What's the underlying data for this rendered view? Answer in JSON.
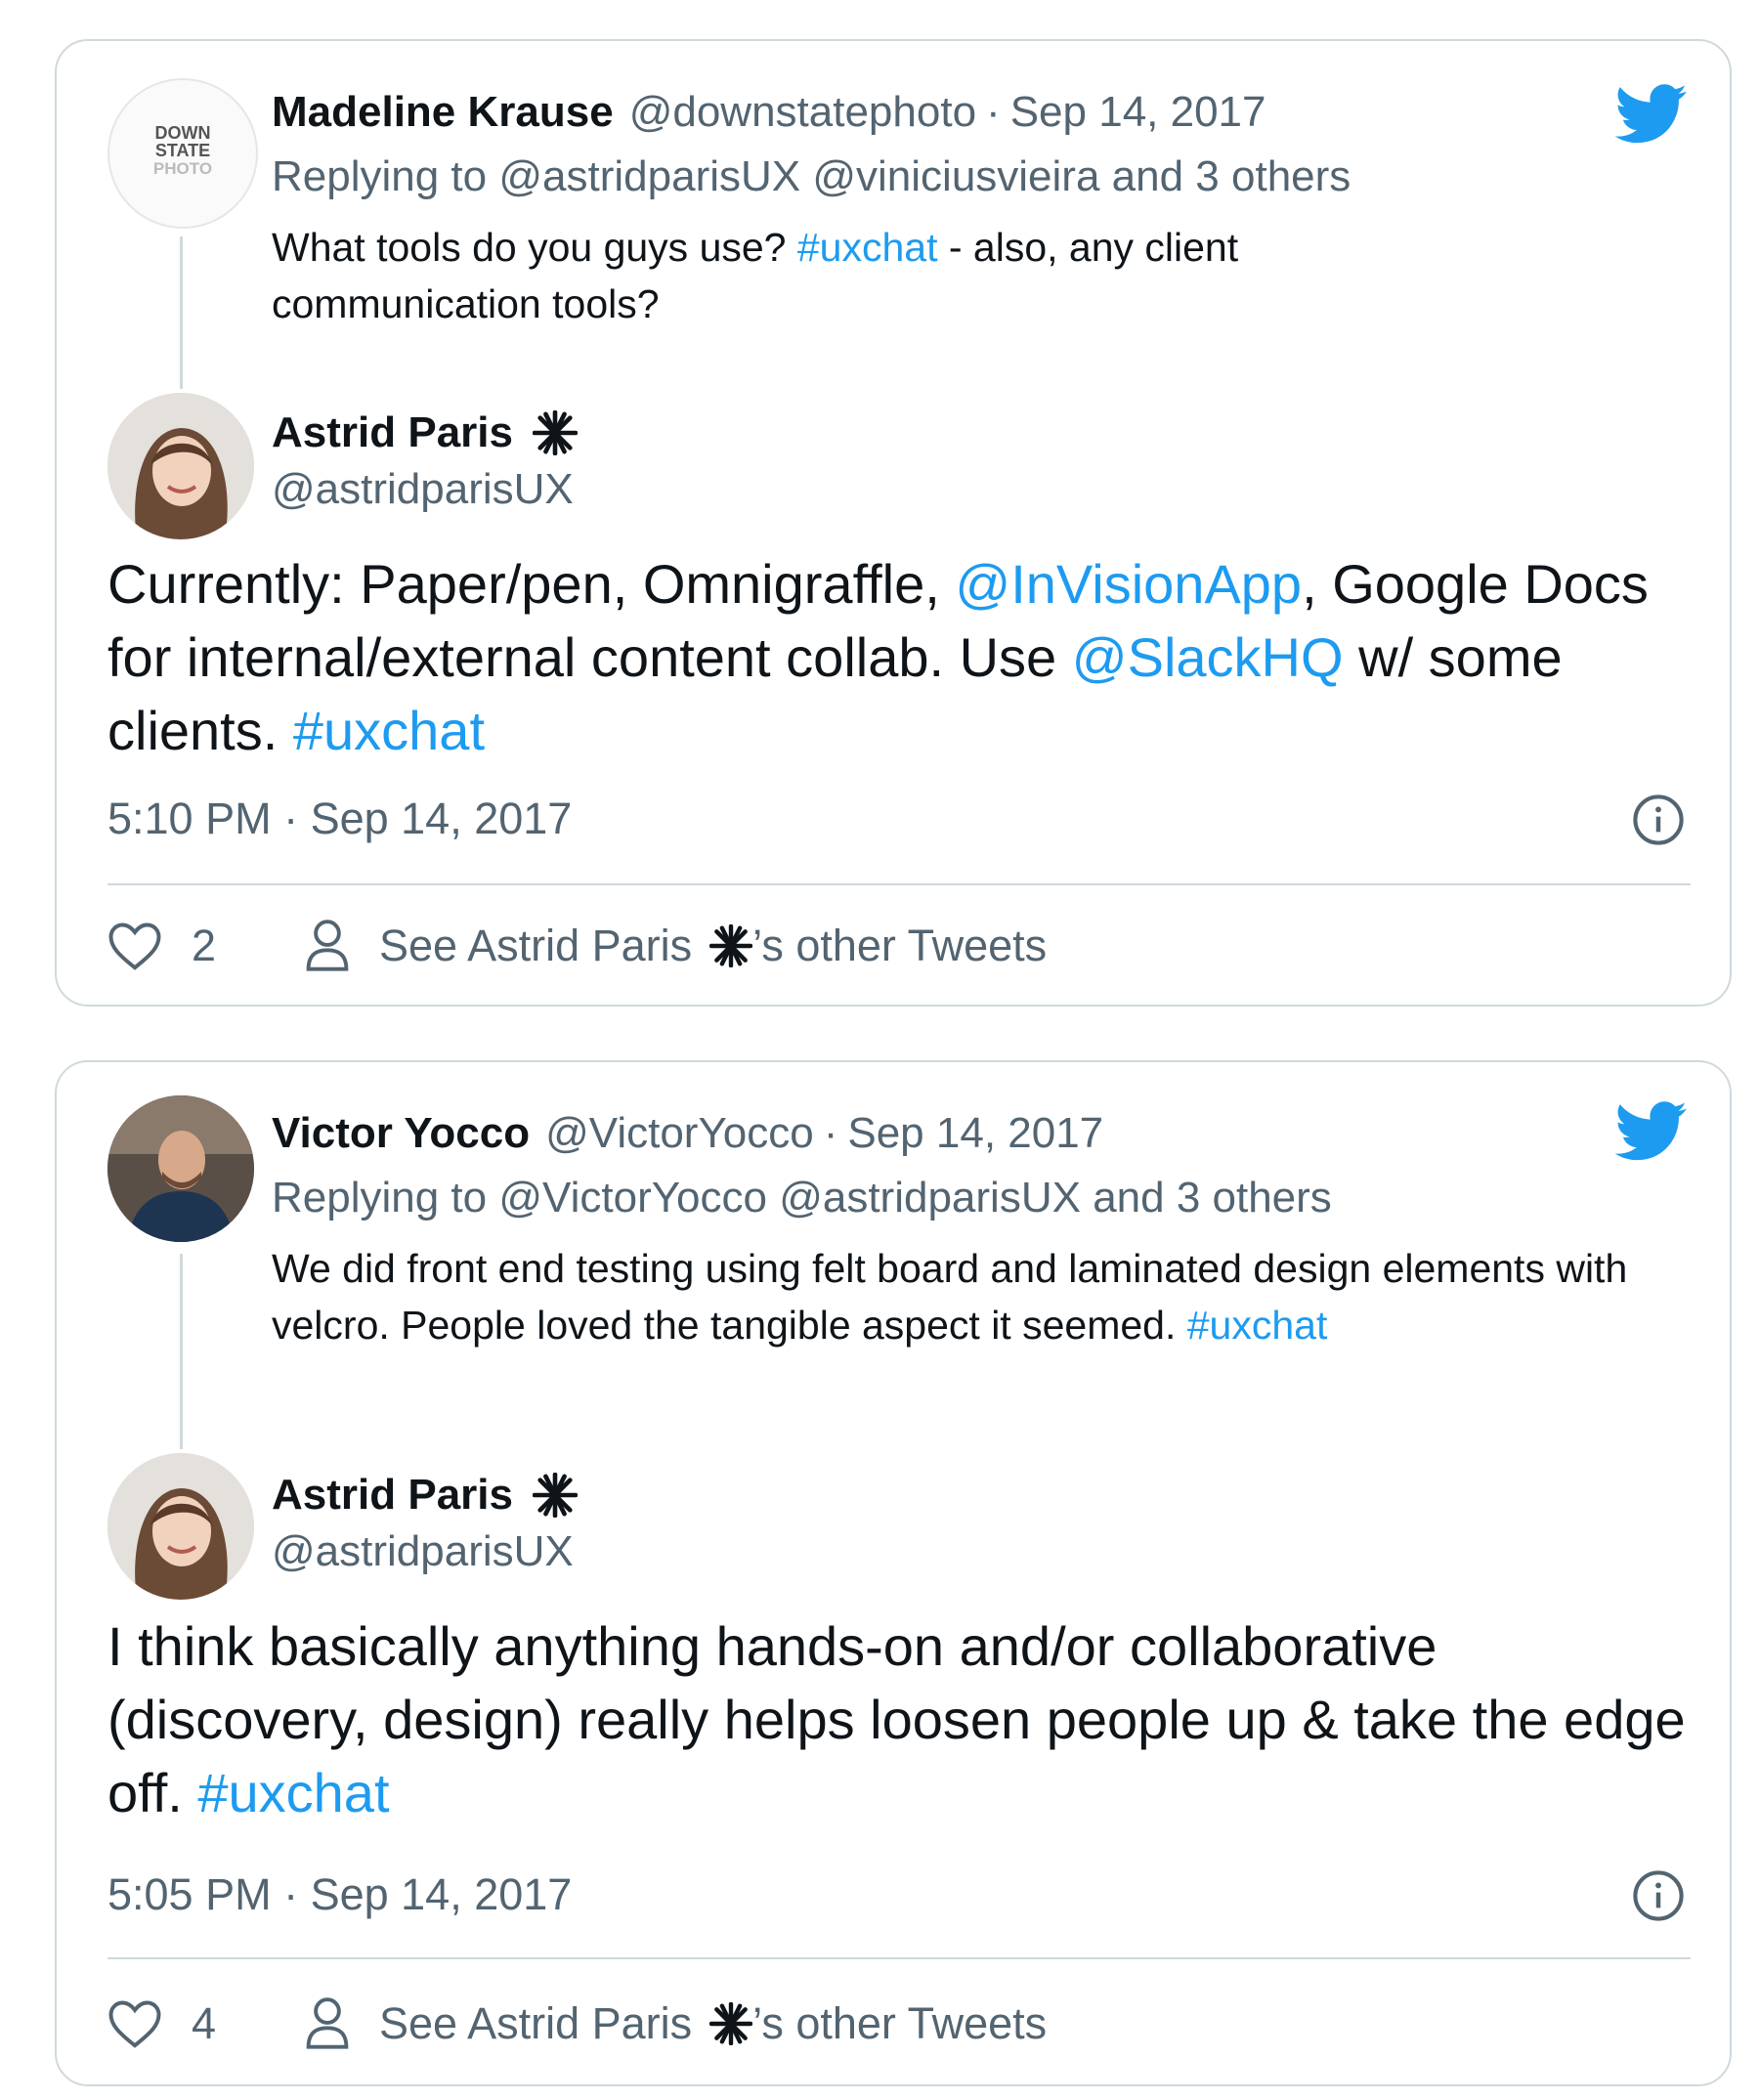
{
  "tweets": [
    {
      "quoted": {
        "author_name": "Madeline Krause",
        "author_handle": "@downstatephoto",
        "date": "Sep 14, 2017",
        "avatar_logo_text": "DOWN STATE PHOTO",
        "replying_label": "Replying to",
        "replying_to": "@astridparisUX @viniciusvieira",
        "replying_others": "and 3 others",
        "text_parts": [
          "What tools do you guys use? ",
          "#uxchat",
          " - also, any client communication tools?"
        ]
      },
      "author_name": "Astrid Paris",
      "author_handle": "@astridparisUX",
      "text_parts": [
        "Currently: Paper/pen, Omnigraffle, ",
        "@InVisionApp",
        ", Google Docs for internal/external content collab. Use ",
        "@SlackHQ",
        " w/ some clients. ",
        "#uxchat"
      ],
      "time": "5:10 PM · Sep 14, 2017",
      "likes": "2",
      "see_other_prefix": "See Astrid Paris",
      "see_other_suffix": "’s other Tweets"
    },
    {
      "quoted": {
        "author_name": "Victor Yocco",
        "author_handle": "@VictorYocco",
        "date": "Sep 14, 2017",
        "replying_label": "Replying to",
        "replying_to": "@VictorYocco @astridparisUX",
        "replying_others": "and 3 others",
        "text_parts": [
          "We did front end testing using felt board and laminated design elements with velcro. People loved the tangible aspect it seemed. ",
          "#uxchat"
        ]
      },
      "author_name": "Astrid Paris",
      "author_handle": "@astridparisUX",
      "text_parts": [
        "I think basically anything hands-on and/or collaborative (discovery, design) really helps loosen people up & take the edge off. ",
        "#uxchat"
      ],
      "time": "5:05 PM · Sep 14, 2017",
      "likes": "4",
      "see_other_prefix": "See Astrid Paris",
      "see_other_suffix": "’s other Tweets"
    }
  ],
  "colors": {
    "link": "#1d9bf0",
    "twitter_bird": "#1d9bf0",
    "muted": "#536471",
    "border": "#cfd9de"
  },
  "icons": [
    "twitter-bird-icon",
    "info-icon",
    "heart-icon",
    "person-icon",
    "sparkle-badge-icon"
  ]
}
